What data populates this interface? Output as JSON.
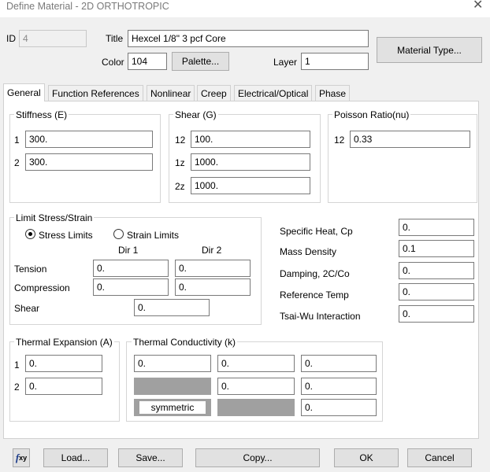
{
  "window": {
    "title": "Define Material - 2D ORTHOTROPIC",
    "close_glyph": "✕"
  },
  "header": {
    "id_label": "ID",
    "id_value": "4",
    "title_label": "Title",
    "title_value": "Hexcel 1/8\" 3 pcf Core",
    "color_label": "Color",
    "color_value": "104",
    "palette_button": "Palette...",
    "layer_label": "Layer",
    "layer_value": "1",
    "material_type_button": "Material Type..."
  },
  "tabs": [
    "General",
    "Function References",
    "Nonlinear",
    "Creep",
    "Electrical/Optical",
    "Phase"
  ],
  "active_tab": "General",
  "stiffness": {
    "label": "Stiffness (E)",
    "rows": [
      {
        "idx": "1",
        "value": "300."
      },
      {
        "idx": "2",
        "value": "300."
      }
    ]
  },
  "shear": {
    "label": "Shear (G)",
    "rows": [
      {
        "idx": "12",
        "value": "100."
      },
      {
        "idx": "1z",
        "value": "1000."
      },
      {
        "idx": "2z",
        "value": "1000."
      }
    ]
  },
  "poisson": {
    "label": "Poisson Ratio(nu)",
    "rows": [
      {
        "idx": "12",
        "value": "0.33"
      }
    ]
  },
  "limit": {
    "label": "Limit Stress/Strain",
    "radio_stress": "Stress Limits",
    "radio_strain": "Strain Limits",
    "selected": "stress",
    "dir1": "Dir 1",
    "dir2": "Dir 2",
    "tension_label": "Tension",
    "tension": [
      "0.",
      "0."
    ],
    "compression_label": "Compression",
    "compression": [
      "0.",
      "0."
    ],
    "shear_label": "Shear",
    "shear": "0."
  },
  "props": [
    {
      "label": "Specific Heat, Cp",
      "value": "0."
    },
    {
      "label": "Mass Density",
      "value": "0.1"
    },
    {
      "label": "Damping, 2C/Co",
      "value": "0."
    },
    {
      "label": "Reference Temp",
      "value": "0."
    },
    {
      "label": "Tsai-Wu Interaction",
      "value": "0."
    }
  ],
  "thermal_expansion": {
    "label": "Thermal Expansion (A)",
    "rows": [
      {
        "idx": "1",
        "value": "0."
      },
      {
        "idx": "2",
        "value": "0."
      }
    ]
  },
  "thermal_conductivity": {
    "label": "Thermal Conductivity (k)",
    "row1": [
      "0.",
      "0.",
      "0."
    ],
    "row2": [
      "0.",
      "0."
    ],
    "row3": [
      "0."
    ],
    "symmetric_label": "symmetric"
  },
  "footer": {
    "fxy_icon": "fxy-icon",
    "fxy_f": "f",
    "fxy_sub": "xy",
    "load": "Load...",
    "save": "Save...",
    "copy": "Copy...",
    "ok": "OK",
    "cancel": "Cancel"
  }
}
